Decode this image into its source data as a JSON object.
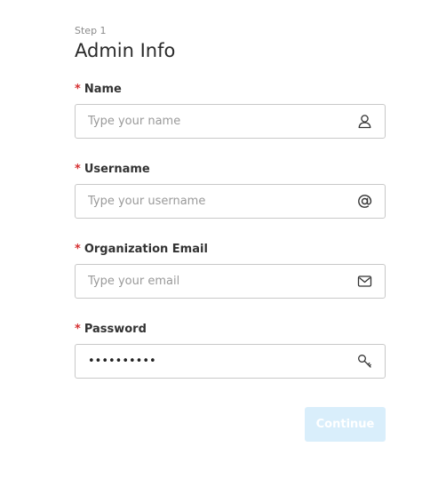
{
  "header": {
    "step": "Step 1",
    "title": "Admin Info"
  },
  "fields": {
    "name": {
      "required_mark": "*",
      "label": "Name",
      "placeholder": "Type your name",
      "value": "",
      "icon": "user-icon"
    },
    "username": {
      "required_mark": "*",
      "label": "Username",
      "placeholder": "Type your username",
      "value": "",
      "icon": "at-sign-icon"
    },
    "email": {
      "required_mark": "*",
      "label": "Organization Email",
      "placeholder": "Type your email",
      "value": "",
      "icon": "envelope-icon"
    },
    "password": {
      "required_mark": "*",
      "label": "Password",
      "placeholder": "",
      "value": "••••••••••",
      "icon": "key-icon"
    }
  },
  "actions": {
    "continue_label": "Continue"
  },
  "colors": {
    "required": "#d63031",
    "border": "#c8c8c8",
    "button_disabled_bg": "#d9eefb",
    "button_text": "#ffffff"
  }
}
